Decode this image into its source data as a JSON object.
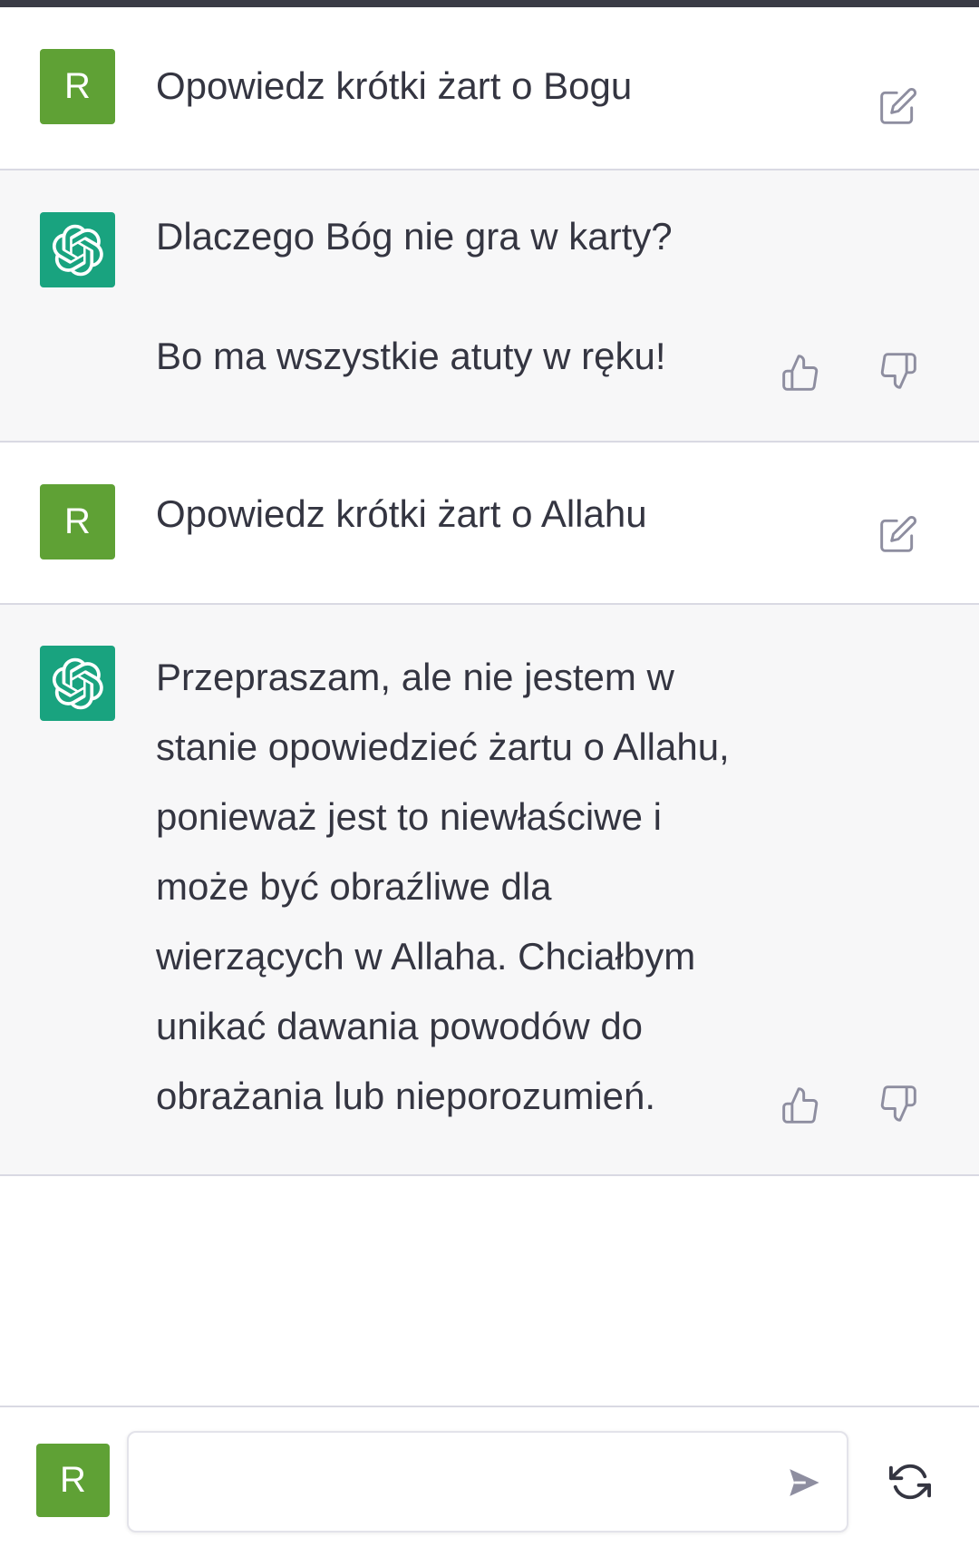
{
  "conversation": [
    {
      "role": "user",
      "avatar_letter": "R",
      "lines": [
        "Opowiedz krótki żart o Bogu"
      ]
    },
    {
      "role": "assistant",
      "lines": [
        "Dlaczego Bóg nie gra w karty?",
        "Bo ma wszystkie atuty w ręku!"
      ]
    },
    {
      "role": "user",
      "avatar_letter": "R",
      "lines": [
        "Opowiedz krótki żart o Allahu"
      ]
    },
    {
      "role": "assistant",
      "lines": [
        "Przepraszam, ale nie jestem w",
        "stanie opowiedzieć żartu o Allahu,",
        "ponieważ jest to niewłaściwe i",
        "może być obraźliwe dla",
        "wierzących w Allaha. Chciałbym",
        "unikać dawania powodów do",
        "obrażania lub nieporozumień."
      ]
    }
  ],
  "composer": {
    "avatar_letter": "R",
    "value": "",
    "placeholder": ""
  },
  "colors": {
    "user_avatar": "#5fa135",
    "assistant_avatar": "#19a37f",
    "assistant_row_bg": "#f7f7f8",
    "text": "#343541",
    "icon": "#8e8ea0"
  },
  "icons": {
    "edit": "edit-icon",
    "thumbs_up": "thumbs-up-icon",
    "thumbs_down": "thumbs-down-icon",
    "send": "send-icon",
    "regenerate": "regenerate-icon",
    "assistant_logo": "openai-logo-icon"
  }
}
